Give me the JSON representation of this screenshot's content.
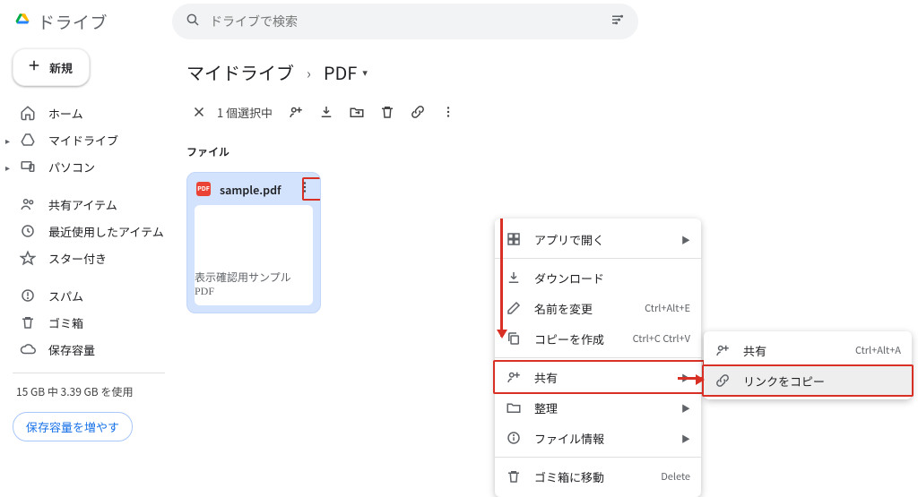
{
  "brand": {
    "name": "ドライブ"
  },
  "search": {
    "placeholder": "ドライブで検索"
  },
  "sidebar": {
    "new_label": "新規",
    "items": [
      {
        "label": "ホーム"
      },
      {
        "label": "マイドライブ"
      },
      {
        "label": "パソコン"
      },
      {
        "label": "共有アイテム"
      },
      {
        "label": "最近使用したアイテム"
      },
      {
        "label": "スター付き"
      },
      {
        "label": "スパム"
      },
      {
        "label": "ゴミ箱"
      },
      {
        "label": "保存容量"
      }
    ],
    "storage_line": "15 GB 中 3.39 GB を使用",
    "upgrade_label": "保存容量を増やす"
  },
  "breadcrumb": {
    "root": "マイドライブ",
    "current": "PDF"
  },
  "selection": {
    "text": "1 個選択中"
  },
  "section": {
    "files_label": "ファイル"
  },
  "file": {
    "name": "sample.pdf",
    "preview_text": "表示確認用サンプル PDF"
  },
  "context_menu": {
    "open_with": {
      "label": "アプリで開く"
    },
    "download": {
      "label": "ダウンロード"
    },
    "rename": {
      "label": "名前を変更",
      "shortcut": "Ctrl+Alt+E"
    },
    "copy": {
      "label": "コピーを作成",
      "shortcut": "Ctrl+C Ctrl+V"
    },
    "share": {
      "label": "共有"
    },
    "organize": {
      "label": "整理"
    },
    "fileinfo": {
      "label": "ファイル情報"
    },
    "trash": {
      "label": "ゴミ箱に移動",
      "shortcut": "Delete"
    }
  },
  "share_submenu": {
    "share": {
      "label": "共有",
      "shortcut": "Ctrl+Alt+A"
    },
    "copy_link": {
      "label": "リンクをコピー"
    }
  }
}
